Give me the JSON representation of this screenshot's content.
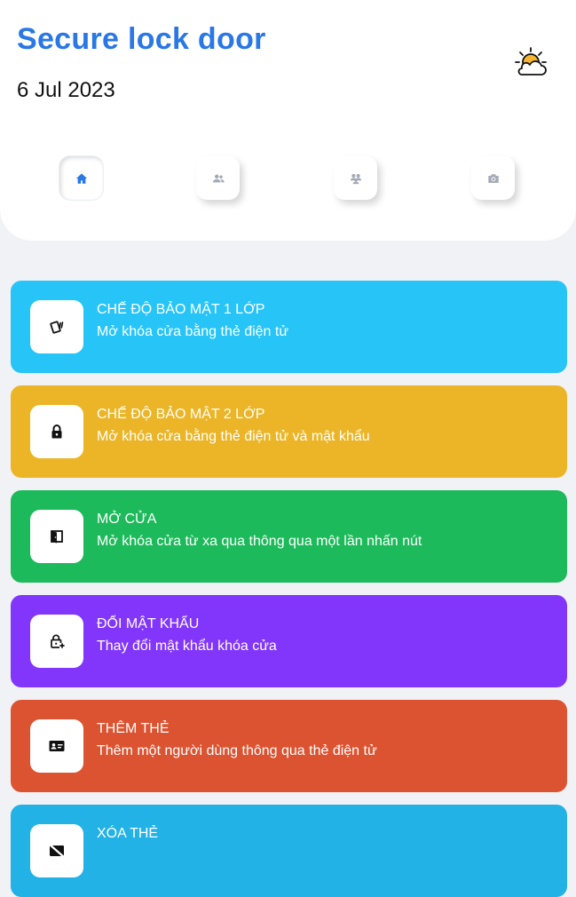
{
  "header": {
    "title": "Secure lock door",
    "date": "6 Jul 2023",
    "weather_icon": "partly-cloudy-icon"
  },
  "nav": [
    {
      "icon": "home-icon",
      "active": true
    },
    {
      "icon": "user-group-icon",
      "active": false
    },
    {
      "icon": "users-icon",
      "active": false
    },
    {
      "icon": "camera-icon",
      "active": false
    }
  ],
  "colors": {
    "title": "#2a77e6",
    "card_1": "#27c4f8",
    "card_2": "#ebb527",
    "card_3": "#1cba5a",
    "card_4": "#8236fb",
    "card_5": "#dc5331",
    "card_6": "#22b2e6"
  },
  "cards": [
    {
      "title": "CHẾ ĐỘ BẢO MẬT 1 LỚP",
      "subtitle": "Mở khóa cửa bằng thẻ điện tử",
      "icon": "card-tap-icon"
    },
    {
      "title": "CHẾ ĐỘ BẢO MẬT 2 LỚP",
      "subtitle": "Mở khóa cửa bằng thẻ điện tử và mật khẩu",
      "icon": "lock-icon"
    },
    {
      "title": "MỞ CỬA",
      "subtitle": "Mở khóa cửa từ xa qua thông qua một lần nhấn nút",
      "icon": "door-open-icon"
    },
    {
      "title": "ĐỔI MẬT KHẨU",
      "subtitle": "Thay đổi mật khẩu khóa cửa",
      "icon": "lock-plus-icon"
    },
    {
      "title": "THÊM THẺ",
      "subtitle": "Thêm một người dùng thông qua thẻ điện tử",
      "icon": "id-card-icon"
    },
    {
      "title": "XÓA THẺ",
      "subtitle": "",
      "icon": "card-remove-icon"
    }
  ]
}
